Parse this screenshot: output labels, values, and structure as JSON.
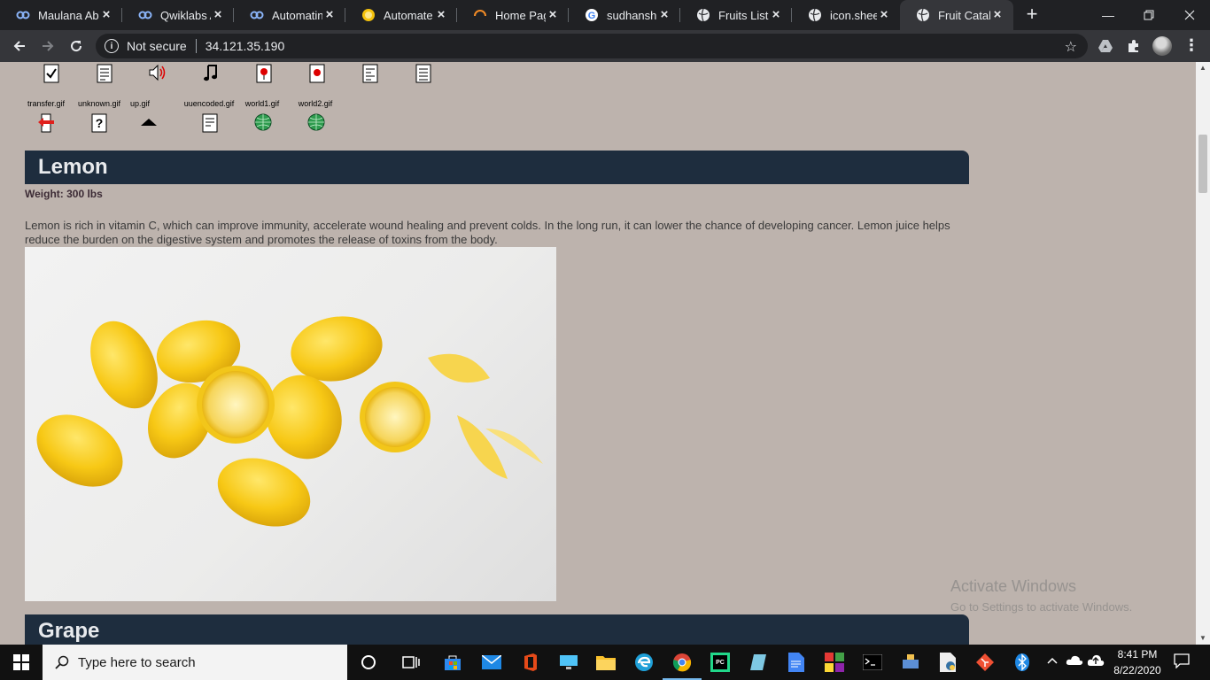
{
  "browser": {
    "tabs": [
      {
        "title": "Maulana Ab",
        "icon": "colab-icon",
        "active": false
      },
      {
        "title": "Qwiklabs A",
        "icon": "colab-icon",
        "active": false
      },
      {
        "title": "Automating",
        "icon": "colab-icon",
        "active": false
      },
      {
        "title": "Automate u",
        "icon": "coin-icon",
        "active": false
      },
      {
        "title": "Home Page",
        "icon": "loading-icon",
        "active": false
      },
      {
        "title": "sudhanshu",
        "icon": "google-icon",
        "active": false
      },
      {
        "title": "Fruits List –",
        "icon": "globe-icon",
        "active": false
      },
      {
        "title": "icon.sheet.p",
        "icon": "globe-icon",
        "active": false
      },
      {
        "title": "Fruit Catalo",
        "icon": "globe-icon",
        "active": true
      }
    ],
    "security_label": "Not secure",
    "url": "34.121.35.190"
  },
  "page": {
    "icons_row1": [
      {
        "name": "check-doc-icon"
      },
      {
        "name": "text-doc-icon"
      },
      {
        "name": "sound-icon"
      },
      {
        "name": "music-note-icon"
      },
      {
        "name": "red-ball-doc-icon"
      },
      {
        "name": "red-ball-doc-icon"
      },
      {
        "name": "script-doc-icon"
      },
      {
        "name": "text-doc-icon"
      }
    ],
    "icons_row2": [
      {
        "caption": "transfer.gif",
        "name": "transfer-icon"
      },
      {
        "caption": "unknown.gif",
        "name": "unknown-icon"
      },
      {
        "caption": "up.gif",
        "name": "up-arrow-icon"
      },
      {
        "caption": "uuencoded.gif",
        "name": "uuencoded-icon"
      },
      {
        "caption": "world1.gif",
        "name": "world-icon"
      },
      {
        "caption": "world2.gif",
        "name": "world-icon"
      }
    ],
    "fruits": [
      {
        "name": "Lemon",
        "weight": "Weight: 300 lbs",
        "description": "Lemon is rich in vitamin C, which can improve immunity, accelerate wound healing and prevent colds. In the long run, it can lower the chance of developing cancer. Lemon juice helps reduce the burden on the digestive system and promotes the release of toxins from the body."
      },
      {
        "name": "Grape"
      }
    ],
    "watermark": {
      "line1": "Activate Windows",
      "line2": "Go to Settings to activate Windows."
    }
  },
  "taskbar": {
    "search_placeholder": "Type here to search",
    "time": "8:41 PM",
    "date": "8/22/2020"
  },
  "colors": {
    "page_bg": "#bdb3ad",
    "section_bar": "#1e2d3e",
    "browser_dark": "#202124",
    "toolbar": "#35363a",
    "lemon_yellow": "#f5c518"
  }
}
